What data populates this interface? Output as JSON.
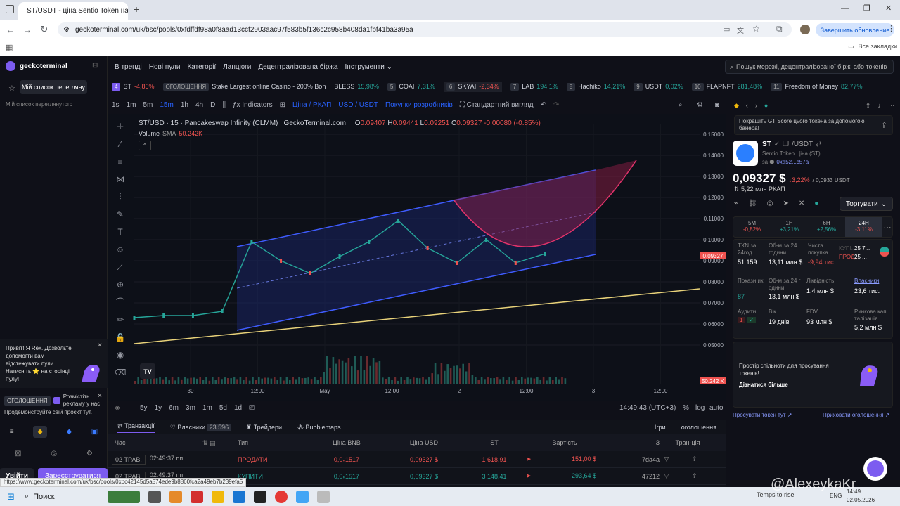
{
  "browser": {
    "tab_title": "ST/USDT - ціна Sentio Token на G",
    "url": "geckoterminal.com/uk/bsc/pools/0xfdffdf98a0f8aad13ccf2903aac97f583b5f136c2c958b408da1fbf41ba3a95a",
    "update_button": "Завершить обновление",
    "bookmarks_label": "Все закладки"
  },
  "sidebar": {
    "logo": "geckoterminal",
    "watchlist_button": "Мій список перегляну",
    "watchlist_label": "Мій список переглянутого",
    "rex_text": "Привіт! Я Rex. Дозвольте допомогти вам відстежувати пули. Натисніть ⭐ на сторінці пулу!",
    "ad_label": "ОГОЛОШЕННЯ",
    "ad_text": "Розмістіть рекламу у нас",
    "promo": "Продемонструйте свій проєкт тут.",
    "login": "Увійти",
    "register": "Зареєструватися"
  },
  "topnav": {
    "items": [
      "В тренді",
      "Нові пули",
      "Категорії",
      "Ланцюги",
      "Децентралізована біржа",
      "Інструменти ⌄"
    ],
    "search_placeholder": "Пошук мережі, децентралізованої біржі або токенів"
  },
  "ticker": [
    {
      "n": "4",
      "sym": "ST",
      "chg": "-4,86%",
      "cls": "neg"
    },
    {
      "n": "ОГОЛОШЕННЯ",
      "sym": "Stake:Largest online Casino - 200% Bon",
      "chg": "",
      "cls": ""
    },
    {
      "n": "",
      "sym": "BLESS",
      "chg": "15,98%",
      "cls": "pos"
    },
    {
      "n": "5",
      "sym": "COAI",
      "chg": "7,31%",
      "cls": "pos"
    },
    {
      "n": "6",
      "sym": "SKYAI",
      "chg": "-2,34%",
      "cls": "neg"
    },
    {
      "n": "7",
      "sym": "LAB",
      "chg": "194,1%",
      "cls": "pos"
    },
    {
      "n": "8",
      "sym": "Hachiko",
      "chg": "14,21%",
      "cls": "pos"
    },
    {
      "n": "9",
      "sym": "USDT",
      "chg": "0,02%",
      "cls": "pos"
    },
    {
      "n": "10",
      "sym": "FLAPNFT",
      "chg": "281,48%",
      "cls": "pos"
    },
    {
      "n": "11",
      "sym": "Freedom of Money",
      "chg": "82,77%",
      "cls": "pos"
    }
  ],
  "chart_toolbar": {
    "intervals": [
      "1s",
      "1m",
      "5m",
      "15m",
      "1h",
      "4h",
      "D"
    ],
    "indicators": "Indicators",
    "price_mcap": "Ціна / РКАП",
    "usd_st": "USD / USDT",
    "devtools": "Покупки розробників",
    "view": "Стандартний вигляд"
  },
  "chart": {
    "title": "ST/USD · 15 · Pancakeswap Infinity (CLMM) | GeckoTerminal.com",
    "ohlc": {
      "o": "0.09407",
      "h": "0.09441",
      "l": "0.09251",
      "c": "0.09327",
      "chg": "-0.00080 (-0.85%)"
    },
    "volume_label": "Volume",
    "volume_sma": "SMA",
    "volume_value": "50.242K",
    "price_ticks": [
      "0.15000",
      "0.14000",
      "0.13000",
      "0.12000",
      "0.11000",
      "0.10000",
      "0.09000",
      "0.08000",
      "0.07000",
      "0.06000",
      "0.05000"
    ],
    "time_ticks": [
      "30",
      "12:00",
      "May",
      "12:00",
      "2",
      "12:00",
      "3",
      "12:00"
    ],
    "last_price_label": "0.09327",
    "vol_badge": "50.242 K"
  },
  "chart_data": {
    "type": "line",
    "series": [
      {
        "name": "ST/USD",
        "x": [
          "2026-04-29 12:00",
          "2026-04-30 00:00",
          "2026-04-30 12:00",
          "2026-04-30 18:00",
          "2026-04-30 21:00",
          "2026-05-01 00:00",
          "2026-05-01 04:00",
          "2026-05-01 08:00",
          "2026-05-01 12:00",
          "2026-05-01 15:00",
          "2026-05-01 20:00",
          "2026-05-02 00:00",
          "2026-05-02 06:00",
          "2026-05-02 12:00",
          "2026-05-02 14:30"
        ],
        "values": [
          0.063,
          0.064,
          0.064,
          0.066,
          0.099,
          0.09,
          0.084,
          0.092,
          0.099,
          0.109,
          0.096,
          0.089,
          0.1,
          0.089,
          0.0933
        ]
      }
    ],
    "ylim": [
      0.045,
      0.155
    ]
  },
  "chart_bottom": {
    "ranges": [
      "5y",
      "1y",
      "6m",
      "3m",
      "1m",
      "5d",
      "1d"
    ],
    "clock": "14:49:43 (UTC+3)",
    "pct": "%",
    "log": "log",
    "auto": "auto"
  },
  "token": {
    "symbol": "ST",
    "pair": "/USDT",
    "name": "Sentio Token Ціна (ST)",
    "address": "0xa52...c57a",
    "price": "0,09327 $",
    "change": "3,22%",
    "price_usdt": "0,0933 USDT",
    "mcap": "5,22 млн РКАП",
    "promo_text": "Покращіть GT Score цього токена за допомогою банера!",
    "trade_button": "Торгувати"
  },
  "timeframes": [
    {
      "label": "5М",
      "val": "-0,82%",
      "cls": "neg"
    },
    {
      "label": "1Н",
      "val": "+3,21%",
      "cls": "pos"
    },
    {
      "label": "6Н",
      "val": "+2,56%",
      "cls": "pos"
    },
    {
      "label": "24Н",
      "val": "-3,11%",
      "cls": "neg"
    }
  ],
  "stats": {
    "txn_label": "TXN за 24год",
    "txn": "51 159",
    "vol_label": "Об-м за 24 години",
    "vol": "13,11 млн $",
    "netbuy_label": "Чиста покупка",
    "netbuy": "-9,94 тис...",
    "buy_label": "КУПІ...",
    "buy": "25 7...",
    "sell_label": "ПРОД...",
    "sell": "25 ...",
    "score_label": "Показн ик",
    "score": "87",
    "vol2_label": "Об-м за 24 г одини",
    "vol2": "13,1 млн $",
    "liq_label": "Ліквідність",
    "liq": "1,4 млн $",
    "holders_label": "Власники",
    "holders": "23,6 тис.",
    "audit_label": "Аудити",
    "audit": "1",
    "age_label": "Вік",
    "age": "19 днів",
    "fdv_label": "FDV",
    "fdv": "93 млн $",
    "mcap_label": "Ринкова капі талізація",
    "mcap": "5,2 млн $"
  },
  "community": {
    "text": "Простір спільноти для просування токенів!",
    "link": "Дізнатися більше",
    "left": "Просувати токен тут ↗",
    "right": "Приховати оголошення ↗"
  },
  "table": {
    "tabs": [
      "Транзакції",
      "Власники",
      "Трейдери",
      "Bubblemaps"
    ],
    "holders_count": "23 596",
    "games": "Ігри",
    "ads": "оголошення",
    "headers": [
      "Час",
      "Тип",
      "Ціна BNB",
      "Ціна USD",
      "ST",
      "Вартість",
      "З",
      "Тран-ція"
    ],
    "rows": [
      {
        "date": "02 ТРАВ.",
        "time": "02:49:37 пп",
        "type": "ПРОДАТИ",
        "cls": "neg",
        "bnb": "0,0₅1517",
        "usd": "0,09327 $",
        "st": "1 618,91",
        "val": "151,00 $",
        "from": "7da4a"
      },
      {
        "date": "02 ТРАВ.",
        "time": "02:49:37 пп",
        "type": "КУПИТИ",
        "cls": "pos",
        "bnb": "0,0₅1517",
        "usd": "0,09327 $",
        "st": "3 148,41",
        "val": "293,64 $",
        "from": "47212"
      }
    ]
  },
  "status_url": "https://www.geckoterminal.com/uk/bsc/pools/0xbc42145d5a574ede9b8860fca2a49eb7b239efa5",
  "taskbar": {
    "search": "Поиск",
    "weather": "Temps to rise",
    "lang": "ENG",
    "time": "14:49",
    "date": "02.05.2026",
    "watermark": "@AlexeykaKr"
  }
}
